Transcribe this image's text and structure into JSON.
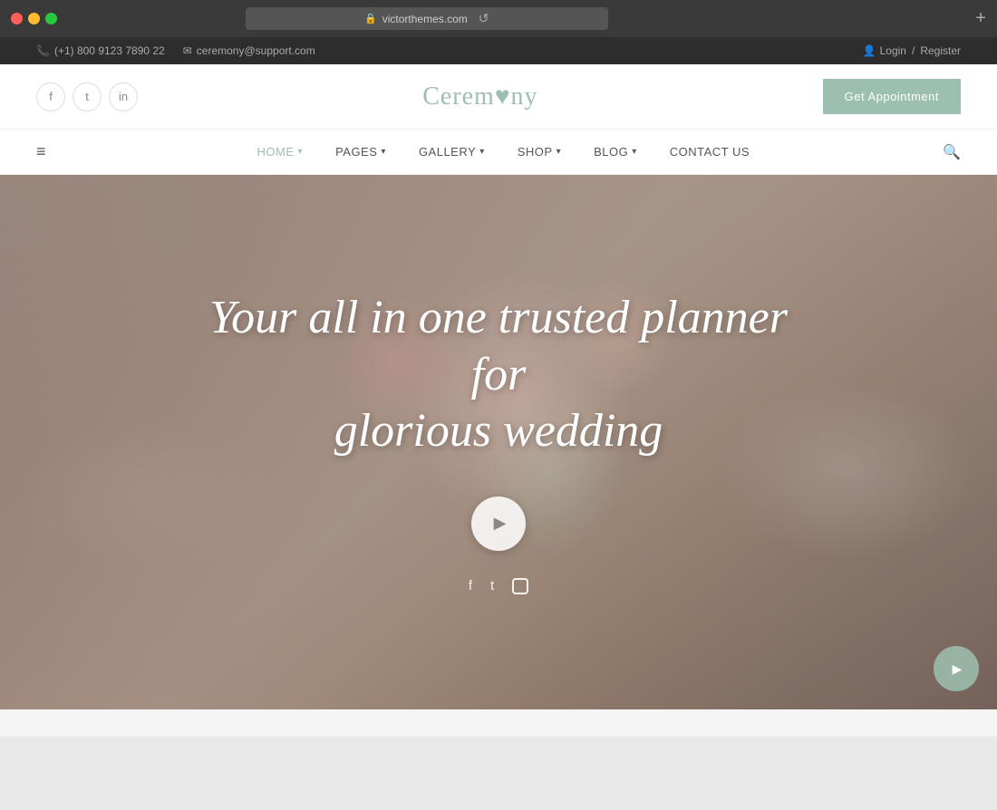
{
  "browser": {
    "url": "victorthemes.com",
    "new_tab_label": "+"
  },
  "topbar": {
    "phone": "(+1) 800 9123 7890 22",
    "email": "ceremony@support.com",
    "login": "Login",
    "separator": "/",
    "register": "Register"
  },
  "header": {
    "logo_text": "Cerem",
    "logo_heart": "♥",
    "logo_end": "ny",
    "cta_label": "Get Appointment",
    "social": {
      "facebook": "f",
      "twitter": "t",
      "linkedin": "in"
    }
  },
  "nav": {
    "hamburger": "≡",
    "items": [
      {
        "label": "HOME",
        "has_arrow": true,
        "active": true
      },
      {
        "label": "PAGES",
        "has_arrow": true,
        "active": false
      },
      {
        "label": "GALLERY",
        "has_arrow": true,
        "active": false
      },
      {
        "label": "SHOP",
        "has_arrow": true,
        "active": false
      },
      {
        "label": "BLOG",
        "has_arrow": true,
        "active": false
      },
      {
        "label": "CONTACT US",
        "has_arrow": false,
        "active": false
      }
    ],
    "search_icon": "🔍"
  },
  "hero": {
    "title_line1": "Your all in one trusted planner for",
    "title_line2": "glorious wedding",
    "play_icon": "▶",
    "social": {
      "facebook": "f",
      "twitter": "t",
      "instagram": "○"
    },
    "floating_play": "▶"
  }
}
